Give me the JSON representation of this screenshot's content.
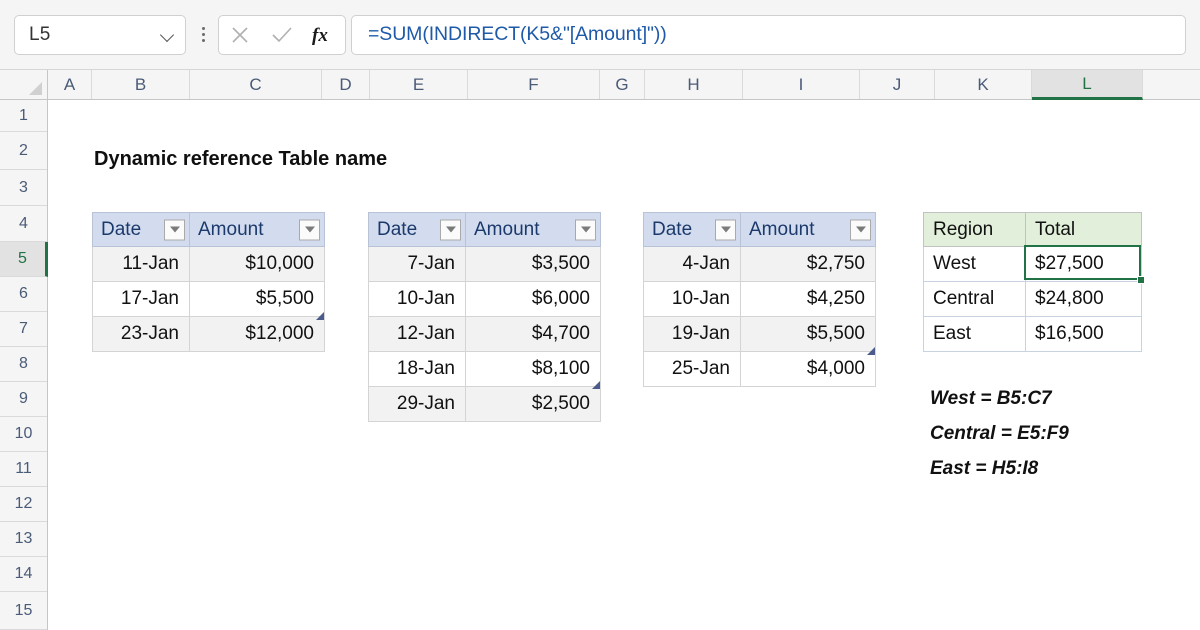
{
  "formula_bar": {
    "name_box_value": "L5",
    "formula": "=SUM(INDIRECT(K5&\"[Amount]\"))",
    "cancel_icon": "close-icon",
    "enter_icon": "check-icon",
    "fx_label": "fx",
    "chevron_icon": "chevron-down-icon",
    "more_icon": "kebab-menu-icon"
  },
  "grid": {
    "columns": [
      "A",
      "B",
      "C",
      "D",
      "E",
      "F",
      "G",
      "H",
      "I",
      "J",
      "K",
      "L"
    ],
    "selected_column": "L",
    "rows": [
      "1",
      "2",
      "3",
      "4",
      "5",
      "6",
      "7",
      "8",
      "9",
      "10",
      "11",
      "12",
      "13",
      "14",
      "15"
    ],
    "selected_row": "5"
  },
  "sheet": {
    "title": "Dynamic reference Table name",
    "selected_cell": "L5"
  },
  "tables": [
    {
      "name": "West",
      "headers": [
        "Date",
        "Amount"
      ],
      "rows": [
        [
          "11-Jan",
          "$10,000"
        ],
        [
          "17-Jan",
          "$5,500"
        ],
        [
          "23-Jan",
          "$12,000"
        ]
      ]
    },
    {
      "name": "Central",
      "headers": [
        "Date",
        "Amount"
      ],
      "rows": [
        [
          "7-Jan",
          "$3,500"
        ],
        [
          "10-Jan",
          "$6,000"
        ],
        [
          "12-Jan",
          "$4,700"
        ],
        [
          "18-Jan",
          "$8,100"
        ],
        [
          "29-Jan",
          "$2,500"
        ]
      ]
    },
    {
      "name": "East",
      "headers": [
        "Date",
        "Amount"
      ],
      "rows": [
        [
          "4-Jan",
          "$2,750"
        ],
        [
          "10-Jan",
          "$4,250"
        ],
        [
          "19-Jan",
          "$5,500"
        ],
        [
          "25-Jan",
          "$4,000"
        ]
      ]
    }
  ],
  "summary": {
    "headers": [
      "Region",
      "Total"
    ],
    "rows": [
      [
        "West",
        "$27,500"
      ],
      [
        "Central",
        "$24,800"
      ],
      [
        "East",
        "$16,500"
      ]
    ]
  },
  "notes": [
    "West = B5:C7",
    "Central = E5:F9",
    "East = H5:I8"
  ],
  "colors": {
    "excel_green": "#217346",
    "table_header_blue": "#d3dcef",
    "summary_header_green": "#e2efda",
    "formula_text_blue": "#1f5aa8"
  }
}
